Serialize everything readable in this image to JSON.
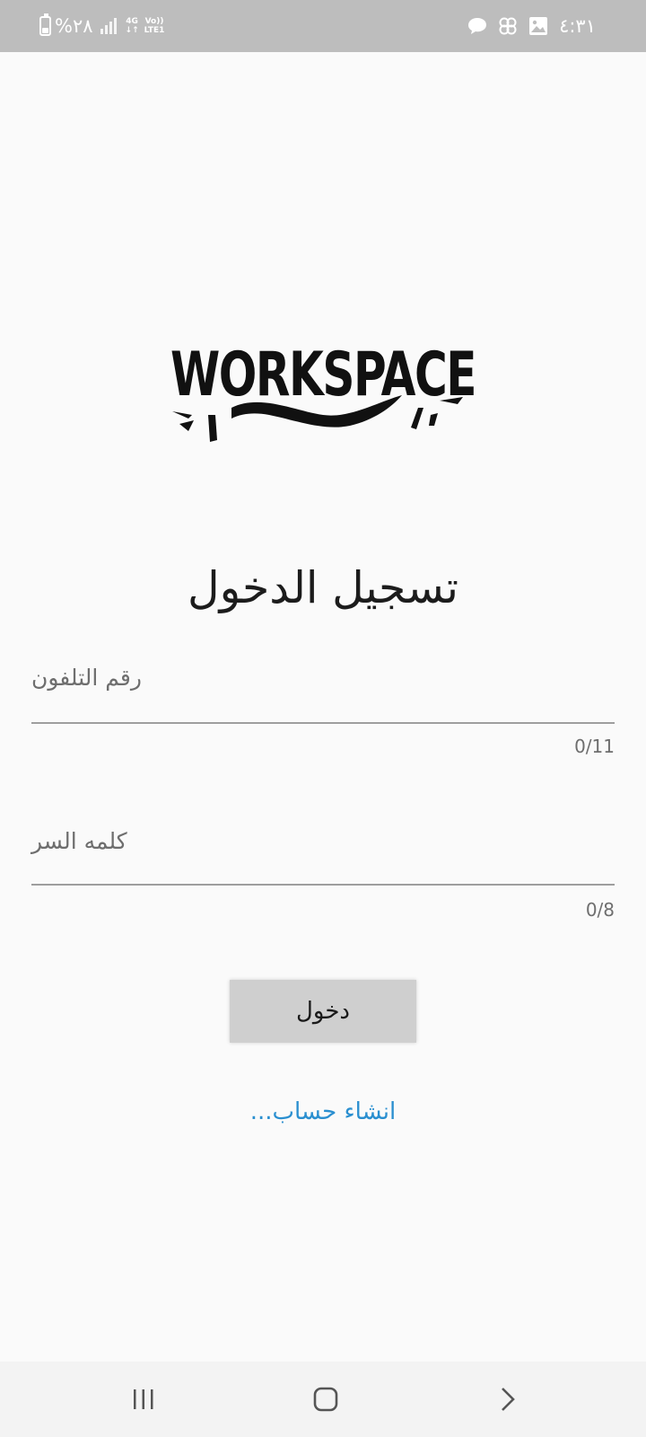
{
  "status_bar": {
    "battery_percent": "%٢٨",
    "network_type": "4G",
    "network_arrows": "↓↑",
    "volte_top": "Vo))",
    "volte_bottom": "LTE1",
    "time": "٤:٣١",
    "icons": [
      "message-bubble-icon",
      "cloverleaf-icon",
      "gallery-icon"
    ]
  },
  "logo": {
    "text": "WORKSPACE"
  },
  "login": {
    "title": "تسجيل الدخول",
    "phone": {
      "label": "رقم التلفون",
      "value": "",
      "counter": "0/11"
    },
    "password": {
      "label": "كلمه السر",
      "value": "",
      "counter": "0/8"
    },
    "submit_label": "دخول",
    "create_account_label": "انشاء حساب..."
  },
  "colors": {
    "background": "#fafafa",
    "status_bar": "#bdbdbd",
    "link": "#2a8fd0",
    "button": "#cfcfcf"
  },
  "nav_bar": {
    "buttons": [
      "recent-apps-icon",
      "home-icon",
      "back-icon"
    ]
  }
}
